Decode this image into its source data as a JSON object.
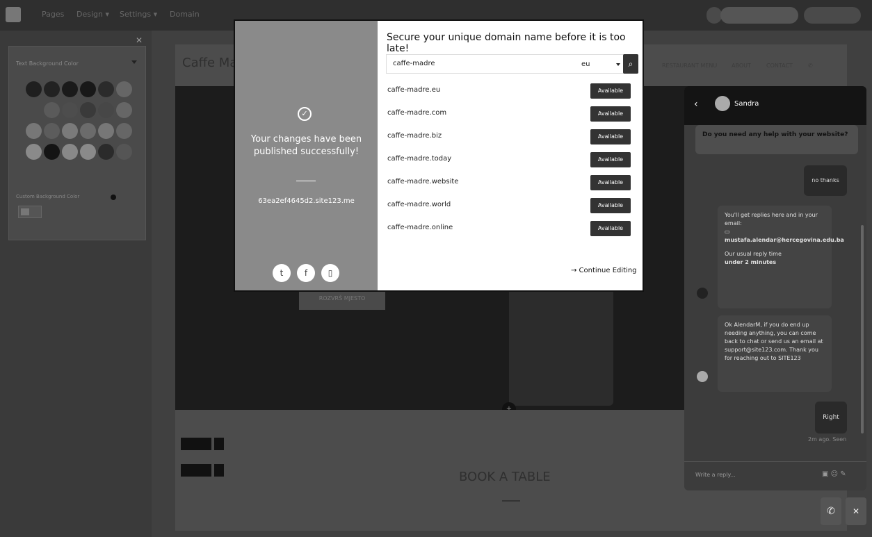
{
  "topbar": {
    "nav": [
      "Pages",
      "Design ▾",
      "Settings ▾",
      "Domain"
    ]
  },
  "left_panel": {
    "title": "Text Background Color",
    "custom_label": "Custom Background Color",
    "swatches": [
      "#1f1f1f",
      "#222222",
      "#1a1a1a",
      "#181818",
      "#2b2b2b",
      "#666666",
      "#4a4a4a",
      "#5a5a5a",
      "#4d4d4d",
      "#3a3a3a",
      "#474747",
      "#666666",
      "#777777",
      "#5c5c5c",
      "#7a7a7a",
      "#6b6b6b",
      "#777777",
      "#666666",
      "#8a8a8a",
      "#141414",
      "#888888",
      "#8a8a8a",
      "#2b2b2b",
      "#555555"
    ]
  },
  "site": {
    "brand": "Caffe Ma",
    "menu": [
      "RESTAURANT MENU",
      "ABOUT",
      "CONTACT"
    ],
    "cta": "ROZVRŠ MJESTO",
    "book": "BOOK A TABLE"
  },
  "modal": {
    "left": {
      "message": "Your changes have been published successfully!",
      "site_url": "63ea2ef4645d2.site123.me"
    },
    "right": {
      "heading": "Secure your unique domain name before it is too late!",
      "search_value": "caffe-madre",
      "tld": "eu",
      "domains": [
        {
          "name": "caffe-madre.eu",
          "status": "Available"
        },
        {
          "name": "caffe-madre.com",
          "status": "Available"
        },
        {
          "name": "caffe-madre.biz",
          "status": "Available"
        },
        {
          "name": "caffe-madre.today",
          "status": "Available"
        },
        {
          "name": "caffe-madre.website",
          "status": "Available"
        },
        {
          "name": "caffe-madre.world",
          "status": "Available"
        },
        {
          "name": "caffe-madre.online",
          "status": "Available"
        }
      ],
      "continue": "→ Continue Editing"
    }
  },
  "chat": {
    "agent": "Sandra",
    "question": "Do you need any help with your website?",
    "no_thanks": "no thanks",
    "b1_line1": "You'll get replies here and in your email:",
    "b1_email": "mustafa.alendar@hercegovina.edu.ba",
    "b1_reply": "Our usual reply time",
    "b1_time": "under 2 minutes",
    "b2_text": "Ok AlendarM, if you do end up needing anything, you can come back to chat or send us an email at support@site123.com. Thank you for reaching out to SITE123",
    "right": "Right",
    "seen": "2m ago. Seen",
    "placeholder": "Write a reply..."
  }
}
